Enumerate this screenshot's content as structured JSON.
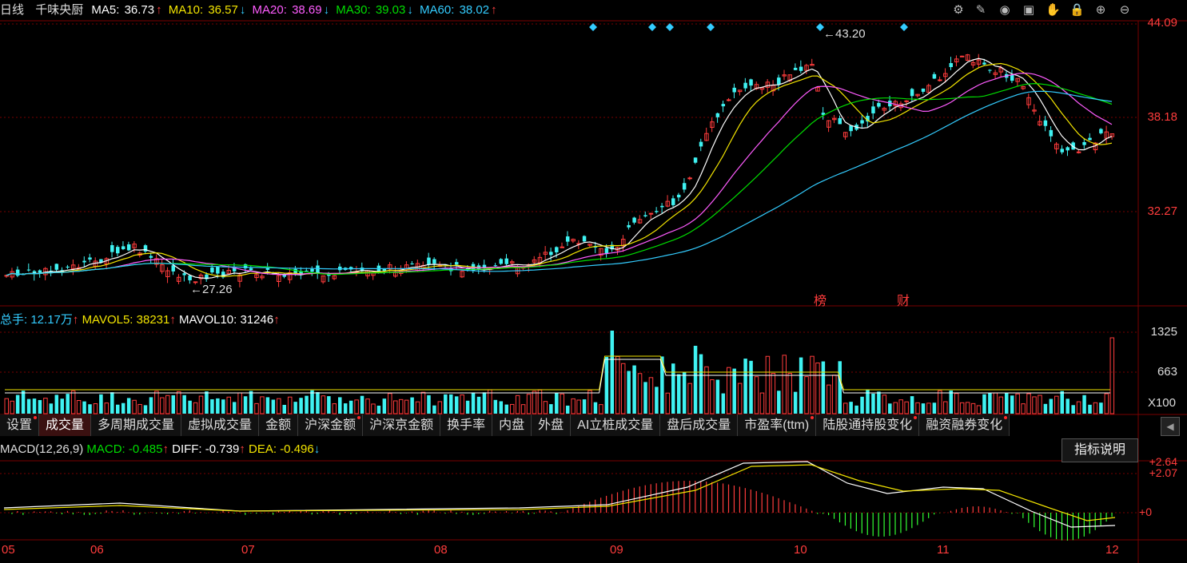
{
  "header": {
    "period": "日线",
    "stock_name": "千味央厨",
    "ma5": {
      "label": "MA5:",
      "value": "36.73",
      "arrow": "↑",
      "color": "#ffffff"
    },
    "ma10": {
      "label": "MA10:",
      "value": "36.57",
      "arrow": "↓",
      "color": "#f2e400"
    },
    "ma20": {
      "label": "MA20:",
      "value": "38.69",
      "arrow": "↓",
      "color": "#ff5cff"
    },
    "ma30": {
      "label": "MA30:",
      "value": "39.03",
      "arrow": "↓",
      "color": "#00dd00"
    },
    "ma60": {
      "label": "MA60:",
      "value": "38.02",
      "arrow": "↑",
      "color": "#33ccff"
    }
  },
  "toolbar_icons": [
    "settings-icon",
    "brush-icon",
    "eye-icon",
    "toolbox-icon",
    "hand-icon",
    "lock-icon",
    "zoom-in-icon",
    "zoom-out-icon"
  ],
  "price_axis": [
    "44.09",
    "38.18",
    "32.27"
  ],
  "annotations": {
    "high": "43.20",
    "low": "27.26",
    "bang": "榜",
    "cai": "财"
  },
  "volume_header": {
    "total_label": "总手:",
    "total_value": "12.17万",
    "total_arrow": "↑",
    "mavol5_label": "MAVOL5:",
    "mavol5_value": "38231",
    "mavol5_arrow": "↑",
    "mavol10_label": "MAVOL10:",
    "mavol10_value": "31246",
    "mavol10_arrow": "↑"
  },
  "volume_axis": [
    "1325",
    "663",
    "X100"
  ],
  "tabs": [
    {
      "label": "设置",
      "dot": true
    },
    {
      "label": "成交量",
      "dot": false,
      "active": true
    },
    {
      "label": "多周期成交量",
      "dot": false
    },
    {
      "label": "虚拟成交量",
      "dot": false
    },
    {
      "label": "金额",
      "dot": false
    },
    {
      "label": "沪深金额",
      "dot": true
    },
    {
      "label": "沪深京金额",
      "dot": false
    },
    {
      "label": "换手率",
      "dot": false
    },
    {
      "label": "内盘",
      "dot": false
    },
    {
      "label": "外盘",
      "dot": false
    },
    {
      "label": "AI立桩成交量",
      "dot": false
    },
    {
      "label": "盘后成交量",
      "dot": false
    },
    {
      "label": "市盈率(ttm)",
      "dot": true
    },
    {
      "label": "陆股通持股变化",
      "dot": true
    },
    {
      "label": "融资融券变化",
      "dot": true
    }
  ],
  "macd_header": {
    "name": "MACD(12,26,9)",
    "macd_label": "MACD:",
    "macd_value": "-0.485",
    "macd_arrow": "↑",
    "diff_label": "DIFF:",
    "diff_value": "-0.739",
    "diff_arrow": "↑",
    "dea_label": "DEA:",
    "dea_value": "-0.496",
    "dea_arrow": "↓"
  },
  "explain_button": "指标说明",
  "macd_axis": [
    "2.64",
    "2.07",
    "0"
  ],
  "date_axis": [
    "05",
    "06",
    "07",
    "08",
    "09",
    "10",
    "11",
    "12"
  ],
  "colors": {
    "up": "#ff3c3c",
    "down": "#3ff2f2",
    "grid": "#7a0000",
    "axis_text": "#ff3c3c"
  }
}
